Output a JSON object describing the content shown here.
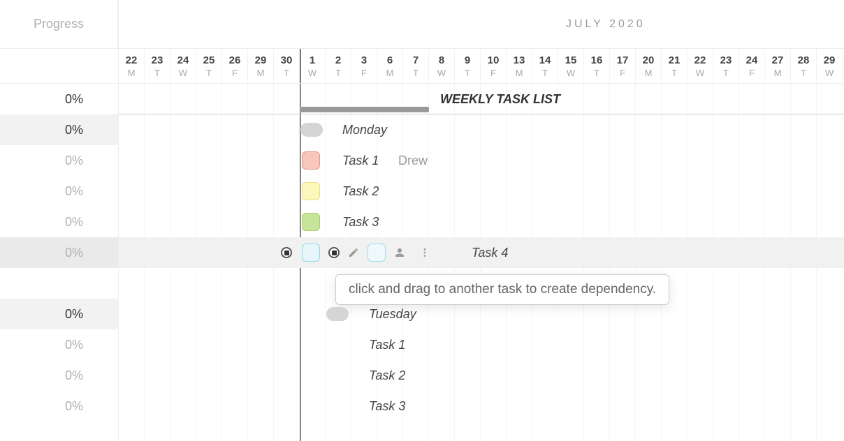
{
  "header": {
    "progress_label": "Progress",
    "month_label": "JULY 2020"
  },
  "days": [
    {
      "n": "22",
      "d": "M"
    },
    {
      "n": "23",
      "d": "T"
    },
    {
      "n": "24",
      "d": "W"
    },
    {
      "n": "25",
      "d": "T"
    },
    {
      "n": "26",
      "d": "F"
    },
    {
      "n": "29",
      "d": "M"
    },
    {
      "n": "30",
      "d": "T"
    },
    {
      "n": "1",
      "d": "W"
    },
    {
      "n": "2",
      "d": "T"
    },
    {
      "n": "3",
      "d": "F"
    },
    {
      "n": "6",
      "d": "M"
    },
    {
      "n": "7",
      "d": "T"
    },
    {
      "n": "8",
      "d": "W"
    },
    {
      "n": "9",
      "d": "T"
    },
    {
      "n": "10",
      "d": "F"
    },
    {
      "n": "13",
      "d": "M"
    },
    {
      "n": "14",
      "d": "T"
    },
    {
      "n": "15",
      "d": "W"
    },
    {
      "n": "16",
      "d": "T"
    },
    {
      "n": "17",
      "d": "F"
    },
    {
      "n": "20",
      "d": "M"
    },
    {
      "n": "21",
      "d": "T"
    },
    {
      "n": "22",
      "d": "W"
    },
    {
      "n": "23",
      "d": "T"
    },
    {
      "n": "24",
      "d": "F"
    },
    {
      "n": "27",
      "d": "M"
    },
    {
      "n": "28",
      "d": "T"
    },
    {
      "n": "29",
      "d": "W"
    }
  ],
  "progress": {
    "r0": "0%",
    "r1": "0%",
    "r2": "0%",
    "r3": "0%",
    "r4": "0%",
    "r5": "0%",
    "r7": "0%",
    "r8": "0%",
    "r9": "0%",
    "r10": "0%"
  },
  "labels": {
    "title": "WEEKLY TASK LIST",
    "monday": "Monday",
    "tuesday": "Tuesday",
    "task1": "Task 1",
    "task2": "Task 2",
    "task3": "Task 3",
    "task4": "Task 4",
    "t2task1": "Task 1",
    "t2task2": "Task 2",
    "t2task3": "Task 3",
    "assignee": "Drew"
  },
  "tooltip": "click and drag to another task to create dependency.",
  "colors": {
    "gray": "#d5d5d5",
    "red": "#f7c7be",
    "yellow": "#fcf7bb",
    "green": "#c7e49a",
    "blue": "#e8f6fb"
  }
}
